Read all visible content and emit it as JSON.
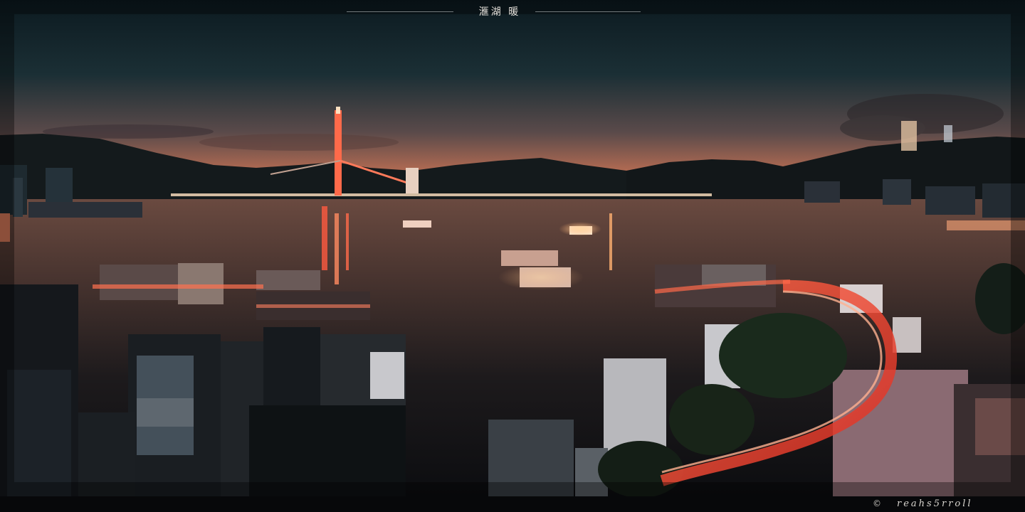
{
  "image": {
    "title": "滙湖 暖",
    "watermark": {
      "copyright_symbol": "©",
      "signature": "reahs5rroll"
    },
    "palette": {
      "sky_top": "#0f1e24",
      "horizon_glow": "#c0705a",
      "water": "#2a1f1d",
      "light_trails": "#ff4a3a",
      "city_lights": "#ffd9b0"
    }
  }
}
